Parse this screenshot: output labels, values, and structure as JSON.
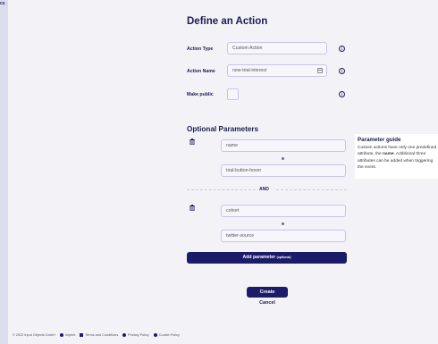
{
  "sidebar": {
    "label": "cs"
  },
  "page": {
    "title": "Define an Action"
  },
  "form": {
    "action_type": {
      "label": "Action Type",
      "value": "Custom Action"
    },
    "action_name": {
      "label": "Action Name",
      "value": "new-trial-interest"
    },
    "make_public": {
      "label": "Make public",
      "checked": false
    }
  },
  "optional_parameters": {
    "title": "Optional Parameters",
    "groups": [
      {
        "key": "name",
        "value": "trial-button-hover"
      },
      {
        "key": "cohort",
        "value": "twitter-source"
      }
    ],
    "separator_label": "AND",
    "add_button": {
      "label": "Add parameter",
      "suffix": "(optional)"
    }
  },
  "guide": {
    "title": "Parameter guide",
    "text_before": "Custom actions have only one predefined attribute, the ",
    "text_bold": "name",
    "text_after": ". Additional three attributes can be added when triggering the event."
  },
  "actions": {
    "create_label": "Create",
    "cancel_label": "Cancel"
  },
  "footer": {
    "copyright": "© 2022 Input Objects GmbH",
    "links": [
      "Imprint",
      "Terms and Conditions",
      "Privacy Policy",
      "Cookie Policy"
    ]
  },
  "colors": {
    "primary": "#1c1b6a",
    "field_border": "#c9c3ea",
    "background": "#f3f3f7"
  },
  "icons": {
    "info": "info-icon",
    "trash": "trash-icon",
    "calendar": "calendar-icon"
  }
}
